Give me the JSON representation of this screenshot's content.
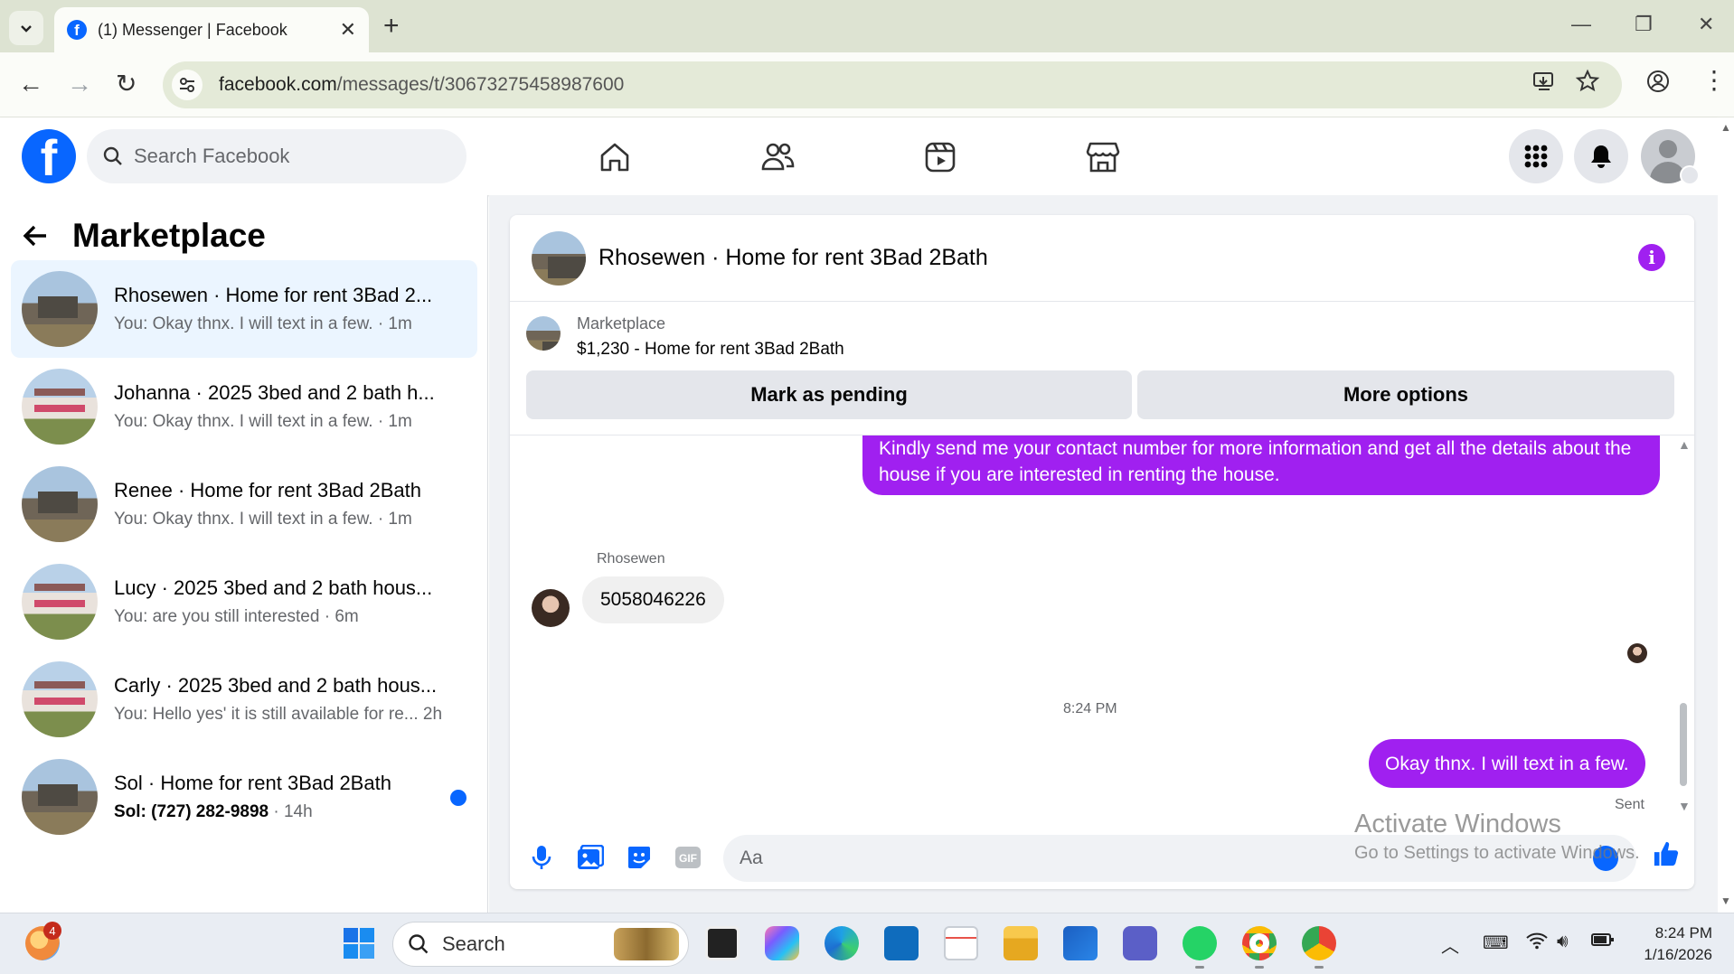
{
  "browser": {
    "tab_title": "(1) Messenger | Facebook",
    "url_host": "facebook.com",
    "url_path": "/messages/t/30673275458987600"
  },
  "fb_header": {
    "search_placeholder": "Search Facebook",
    "nav_icons": [
      "home-icon",
      "friends-icon",
      "video-icon",
      "marketplace-icon"
    ]
  },
  "sidebar": {
    "title": "Marketplace",
    "conversations": [
      {
        "name": "Rhosewen · Home for rent 3Bad 2...",
        "preview": "You: Okay thnx. I will text in a few. · 1m",
        "active": true,
        "thumb": "house-a"
      },
      {
        "name": "Johanna · 2025 3bed and 2 bath h...",
        "preview": "You: Okay thnx. I will text in a few. · 1m",
        "thumb": "house-b"
      },
      {
        "name": "Renee · Home for rent 3Bad 2Bath",
        "preview": "You: Okay thnx. I will text in a few. · 1m",
        "thumb": "house-a"
      },
      {
        "name": "Lucy · 2025 3bed and 2 bath hous...",
        "preview": "You: are you still interested · 6m",
        "thumb": "house-b"
      },
      {
        "name": "Carly · 2025 3bed and 2 bath hous...",
        "preview": "You: Hello yes' it is still available for re...  2h",
        "thumb": "house-b"
      },
      {
        "name": "Sol · Home for rent 3Bad 2Bath",
        "preview": "Sol: (727) 282-9898",
        "preview_time": " · 14h",
        "unread": true,
        "thumb": "house-a"
      }
    ]
  },
  "chat": {
    "title": "Rhosewen · Home for rent 3Bad 2Bath",
    "listing": {
      "category": "Marketplace",
      "price_title": "$1,230 - Home for rent 3Bad 2Bath",
      "mark_pending_label": "Mark as pending",
      "more_options_label": "More options"
    },
    "messages": {
      "outgoing_1": "Kindly send me your contact number for more information and get all the details about the house if you are interested in renting the house.",
      "incoming_sender": "Rhosewen",
      "incoming_1": "5058046226",
      "timestamp": "8:24 PM",
      "outgoing_2": "Okay thnx. I will text in a few.",
      "status": "Sent"
    },
    "composer_placeholder": "Aa"
  },
  "watermark": {
    "line1": "Activate Windows",
    "line2": "Go to Settings to activate Windows."
  },
  "taskbar": {
    "search_label": "Search",
    "notification_badge": "4",
    "clock_time": "8:24 PM",
    "clock_date": "1/16/2026"
  },
  "colors": {
    "fb_blue": "#0866ff",
    "message_purple": "#a020f0",
    "active_row": "#ebf5ff"
  }
}
